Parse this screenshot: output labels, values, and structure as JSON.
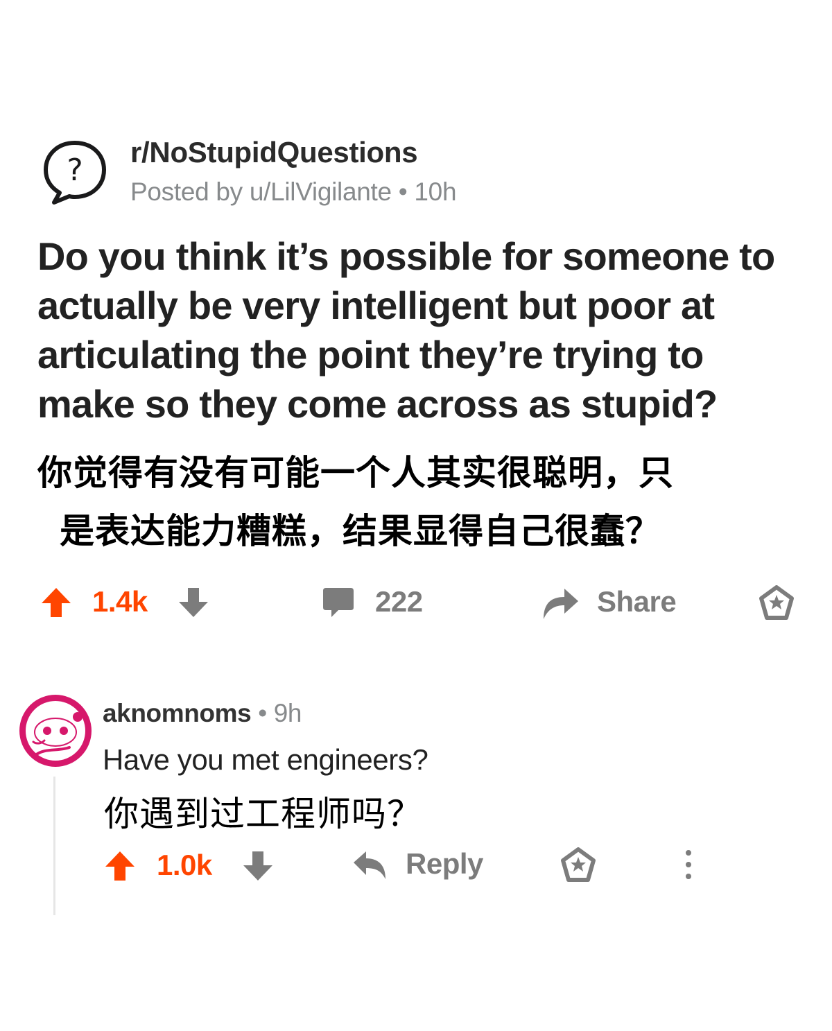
{
  "post": {
    "subreddit": "r/NoStupidQuestions",
    "posted_by": "Posted by u/LilVigilante",
    "separator": "•",
    "age": "10h",
    "title": "Do you think it’s possible for someone to actually be very intelligent but poor at articulating the point they’re trying to make so they come across as stupid?",
    "title_zh_line1": "你觉得有没有可能一个人其实很聪明，只",
    "title_zh_line2": "是表达能力糟糕，结果显得自己很蠢？",
    "score": "1.4k",
    "comments": "222",
    "share_label": "Share",
    "icons": [
      "question-bubble-icon",
      "upvote-icon",
      "downvote-icon",
      "comment-icon",
      "share-icon",
      "award-icon"
    ]
  },
  "comment": {
    "author": "aknomnoms",
    "separator": "•",
    "age": "9h",
    "body": "Have you met engineers?",
    "body_zh": "你遇到过工程师吗？",
    "score": "1.0k",
    "reply_label": "Reply",
    "icons": [
      "avatar",
      "upvote-icon",
      "downvote-icon",
      "reply-icon",
      "award-icon",
      "more-options-icon"
    ]
  },
  "colors": {
    "accent": "#ff4500",
    "muted": "#878a8c",
    "avatar_ring": "#d6186b"
  }
}
